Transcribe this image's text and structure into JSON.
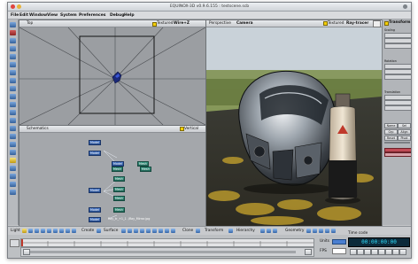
{
  "window": {
    "title": "EQUINOX-3D v0.9.6.155 : testscene.scb"
  },
  "menu": [
    "File",
    "Edit",
    "Window",
    "View",
    "System",
    "Preferences",
    "Debug",
    "Help"
  ],
  "top_view": {
    "title": "Top",
    "textured_label": "Textured",
    "wire_label": "Wire+Z"
  },
  "schematics": {
    "title": "Schematics",
    "vertical_label": "Vertical",
    "nodes": [
      "Model",
      "Model",
      "Model",
      "Model",
      "Model",
      "Model"
    ],
    "green_nodes": [
      "Mesh",
      "Mesh",
      "Mesh",
      "Mesh",
      "Mesh",
      "Mesh",
      "Mesh"
    ],
    "path_label": "Ray_tr_+1_1 ./Ray_Mirror.jpg"
  },
  "perspective": {
    "title": "Perspective",
    "camera_label": "Camera",
    "textured_label": "Textured",
    "raytracer_label": "Ray-tracer"
  },
  "transform": {
    "title": "Transform",
    "labels": [
      "Scaling",
      "Rotation",
      "Translation"
    ],
    "buttons": [
      "Name",
      "Sel",
      "Grp",
      "Align",
      "Reset",
      "Pivot"
    ]
  },
  "bottombar": {
    "light_label": "Light",
    "create_label": "Create",
    "surface_label": "Surface",
    "clone_label": "Clone",
    "transform_label": "Transform",
    "hierarchy_label": "Hierarchy",
    "geometry_label": "Geometry"
  },
  "timeline": {
    "units_label": "Units",
    "time_code_label": "Time code",
    "time_code": "00:00:00:00",
    "fps_label": "FPS"
  }
}
